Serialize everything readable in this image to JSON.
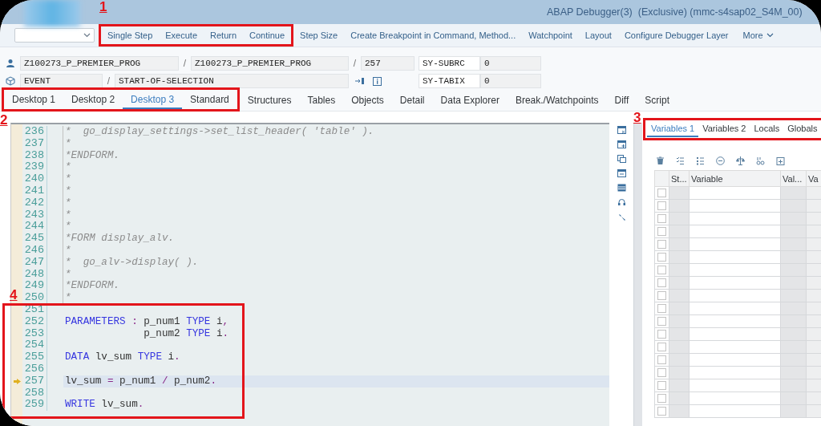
{
  "window": {
    "title": "ABAP Debugger(3)  (Exclusive) (mmc-s4sap02_S4M_00)"
  },
  "toolbar": {
    "annotation": "1",
    "buttons": [
      {
        "label": "Single Step",
        "annotated": true
      },
      {
        "label": "Execute",
        "annotated": true
      },
      {
        "label": "Return",
        "annotated": true
      },
      {
        "label": "Continue",
        "annotated": true
      },
      {
        "label": "Step Size",
        "annotated": false
      },
      {
        "label": "Create Breakpoint in Command, Method...",
        "annotated": false
      },
      {
        "label": "Watchpoint",
        "annotated": false
      },
      {
        "label": "Layout",
        "annotated": false
      },
      {
        "label": "Configure Debugger Layer",
        "annotated": false
      }
    ],
    "more": {
      "label": "More"
    }
  },
  "info": {
    "rows": [
      {
        "main": "Z100273_P_PREMIER_PROG",
        "separator_1": "/",
        "include": "Z100273_P_PREMIER_PROG",
        "separator_2": "/",
        "line": "257",
        "sysfield": "SY-SUBRC",
        "sysvalue": "0"
      },
      {
        "main": "EVENT",
        "separator_1": "/",
        "include": "START-OF-SELECTION",
        "sysfield": "SY-TABIX",
        "sysvalue": "0"
      }
    ]
  },
  "tabs": {
    "annotation": "2",
    "items": [
      {
        "label": "Desktop 1",
        "selected": false,
        "annotated": true
      },
      {
        "label": "Desktop 2",
        "selected": false,
        "annotated": true
      },
      {
        "label": "Desktop 3",
        "selected": true,
        "annotated": true
      },
      {
        "label": "Standard",
        "selected": false,
        "annotated": true
      },
      {
        "label": "Structures",
        "selected": false,
        "annotated": false
      },
      {
        "label": "Tables",
        "selected": false,
        "annotated": false
      },
      {
        "label": "Objects",
        "selected": false,
        "annotated": false
      },
      {
        "label": "Detail",
        "selected": false,
        "annotated": false
      },
      {
        "label": "Data Explorer",
        "selected": false,
        "annotated": false
      },
      {
        "label": "Break./Watchpoints",
        "selected": false,
        "annotated": false
      },
      {
        "label": "Diff",
        "selected": false,
        "annotated": false
      },
      {
        "label": "Script",
        "selected": false,
        "annotated": false
      }
    ]
  },
  "code": {
    "annotation": "4",
    "lines": [
      {
        "number": "236",
        "block": true,
        "current": false,
        "annotated": false,
        "segments": [
          {
            "kind": "comment",
            "text": "*  go_display_settings->set_list_header( 'table' )."
          }
        ]
      },
      {
        "number": "237",
        "block": true,
        "current": false,
        "annotated": false,
        "segments": [
          {
            "kind": "comment",
            "text": "*"
          }
        ]
      },
      {
        "number": "238",
        "block": true,
        "current": false,
        "annotated": false,
        "segments": [
          {
            "kind": "comment",
            "text": "*ENDFORM."
          }
        ]
      },
      {
        "number": "239",
        "block": true,
        "current": false,
        "annotated": false,
        "segments": [
          {
            "kind": "comment",
            "text": "*"
          }
        ]
      },
      {
        "number": "240",
        "block": true,
        "current": false,
        "annotated": false,
        "segments": [
          {
            "kind": "comment",
            "text": "*"
          }
        ]
      },
      {
        "number": "241",
        "block": true,
        "current": false,
        "annotated": false,
        "segments": [
          {
            "kind": "comment",
            "text": "*"
          }
        ]
      },
      {
        "number": "242",
        "block": true,
        "current": false,
        "annotated": false,
        "segments": [
          {
            "kind": "comment",
            "text": "*"
          }
        ]
      },
      {
        "number": "243",
        "block": true,
        "current": false,
        "annotated": false,
        "segments": [
          {
            "kind": "comment",
            "text": "*"
          }
        ]
      },
      {
        "number": "244",
        "block": true,
        "current": false,
        "annotated": false,
        "segments": [
          {
            "kind": "comment",
            "text": "*"
          }
        ]
      },
      {
        "number": "245",
        "block": true,
        "current": false,
        "annotated": false,
        "segments": [
          {
            "kind": "comment",
            "text": "*FORM display_alv."
          }
        ]
      },
      {
        "number": "246",
        "block": true,
        "current": false,
        "annotated": false,
        "segments": [
          {
            "kind": "comment",
            "text": "*"
          }
        ]
      },
      {
        "number": "247",
        "block": true,
        "current": false,
        "annotated": false,
        "segments": [
          {
            "kind": "comment",
            "text": "*  go_alv->display( )."
          }
        ]
      },
      {
        "number": "248",
        "block": true,
        "current": false,
        "annotated": false,
        "segments": [
          {
            "kind": "comment",
            "text": "*"
          }
        ]
      },
      {
        "number": "249",
        "block": true,
        "current": false,
        "annotated": false,
        "segments": [
          {
            "kind": "comment",
            "text": "*ENDFORM."
          }
        ]
      },
      {
        "number": "250",
        "block": true,
        "current": false,
        "annotated": false,
        "segments": [
          {
            "kind": "comment",
            "text": "*"
          }
        ]
      },
      {
        "number": "251",
        "block": false,
        "current": false,
        "annotated": true
      },
      {
        "number": "252",
        "block": false,
        "current": false,
        "annotated": true,
        "segments": [
          {
            "kind": "keyword",
            "text": "PARAMETERS"
          },
          {
            "kind": "op",
            "text": " : "
          },
          {
            "kind": "plain",
            "text": "p_num1 "
          },
          {
            "kind": "keyword",
            "text": "TYPE"
          },
          {
            "kind": "plain",
            "text": " i"
          },
          {
            "kind": "op",
            "text": ","
          }
        ]
      },
      {
        "number": "253",
        "block": false,
        "current": false,
        "annotated": true,
        "segments": [
          {
            "kind": "plain",
            "text": "             p_num2 "
          },
          {
            "kind": "keyword",
            "text": "TYPE"
          },
          {
            "kind": "plain",
            "text": " i"
          },
          {
            "kind": "op",
            "text": "."
          }
        ]
      },
      {
        "number": "254",
        "block": false,
        "current": false,
        "annotated": true
      },
      {
        "number": "255",
        "block": false,
        "current": false,
        "annotated": true,
        "segments": [
          {
            "kind": "keyword",
            "text": "DATA"
          },
          {
            "kind": "plain",
            "text": " lv_sum "
          },
          {
            "kind": "keyword",
            "text": "TYPE"
          },
          {
            "kind": "plain",
            "text": " i"
          },
          {
            "kind": "op",
            "text": "."
          }
        ]
      },
      {
        "number": "256",
        "block": false,
        "current": false,
        "annotated": true
      },
      {
        "number": "257",
        "block": false,
        "current": true,
        "annotated": true,
        "segments": [
          {
            "kind": "plain",
            "text": "lv_sum "
          },
          {
            "kind": "op",
            "text": "="
          },
          {
            "kind": "plain",
            "text": " p_num1 "
          },
          {
            "kind": "op",
            "text": "/"
          },
          {
            "kind": "plain",
            "text": " p_num2"
          },
          {
            "kind": "op",
            "text": "."
          }
        ]
      },
      {
        "number": "258",
        "block": false,
        "current": false,
        "annotated": true
      },
      {
        "number": "259",
        "block": false,
        "current": false,
        "annotated": true,
        "segments": [
          {
            "kind": "keyword",
            "text": "WRITE"
          },
          {
            "kind": "plain",
            "text": " lv_sum"
          },
          {
            "kind": "op",
            "text": "."
          }
        ]
      }
    ]
  },
  "variables": {
    "annotation": "3",
    "tabs": [
      {
        "label": "Variables 1",
        "selected": true
      },
      {
        "label": "Variables 2",
        "selected": false
      },
      {
        "label": "Locals",
        "selected": false
      },
      {
        "label": "Globals",
        "selected": false
      }
    ],
    "columns": [
      {
        "label": "St..."
      },
      {
        "label": "Variable"
      },
      {
        "label": "Val..."
      },
      {
        "label": "Va"
      }
    ],
    "rows": [
      {
        "checked": false
      },
      {
        "checked": false
      },
      {
        "checked": false
      },
      {
        "checked": false
      },
      {
        "checked": false
      },
      {
        "checked": false
      },
      {
        "checked": false
      },
      {
        "checked": false
      },
      {
        "checked": false
      },
      {
        "checked": false
      },
      {
        "checked": false
      },
      {
        "checked": false
      },
      {
        "checked": false
      },
      {
        "checked": false
      },
      {
        "checked": false
      },
      {
        "checked": false
      },
      {
        "checked": false
      },
      {
        "checked": false
      }
    ]
  }
}
